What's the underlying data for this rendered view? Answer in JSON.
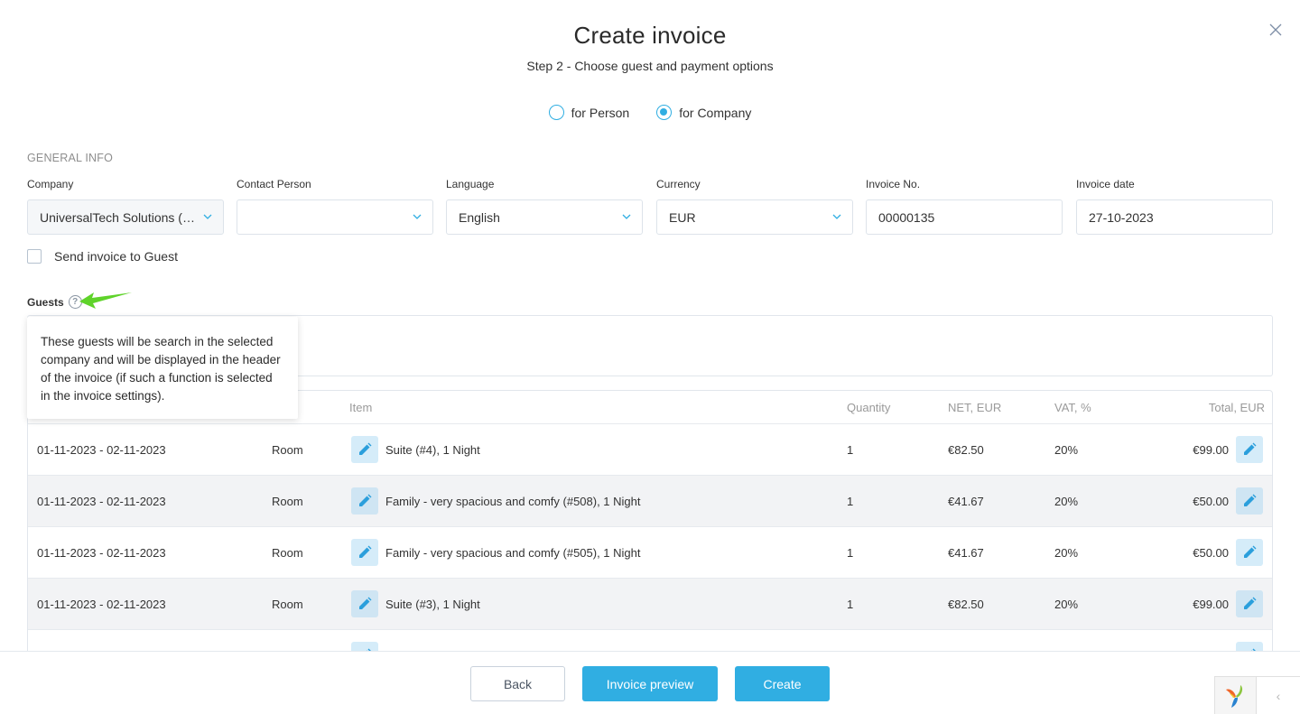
{
  "header": {
    "title": "Create invoice",
    "subtitle": "Step 2 - Choose guest and payment options"
  },
  "recipient_type": {
    "options": [
      {
        "label": "for Person",
        "selected": false
      },
      {
        "label": "for Company",
        "selected": true
      }
    ]
  },
  "general_info": {
    "section_title": "GENERAL INFO",
    "company": {
      "label": "Company",
      "value": "UniversalTech Solutions (B..."
    },
    "contact_person": {
      "label": "Contact Person",
      "value": ""
    },
    "language": {
      "label": "Language",
      "value": "English"
    },
    "currency": {
      "label": "Currency",
      "value": "EUR"
    },
    "invoice_no": {
      "label": "Invoice No.",
      "value": "00000135"
    },
    "invoice_date": {
      "label": "Invoice date",
      "value": "27-10-2023"
    },
    "send_to_guest": {
      "label": "Send invoice to Guest",
      "checked": false
    }
  },
  "guests": {
    "label": "Guests",
    "help_icon": "question-circle-icon",
    "tooltip": "These guests will be search in the selected company and will be displayed in the header of the invoice (if such a function is selected in the invoice settings)."
  },
  "table": {
    "columns": {
      "item": "Item",
      "quantity": "Quantity",
      "net": "NET, EUR",
      "vat": "VAT, %",
      "total": "Total, EUR"
    },
    "rows": [
      {
        "dates": "01-11-2023 - 02-11-2023",
        "type": "Room",
        "item": "Suite  (#4), 1 Night",
        "quantity": "1",
        "net": "€82.50",
        "vat": "20%",
        "total": "€99.00"
      },
      {
        "dates": "01-11-2023 - 02-11-2023",
        "type": "Room",
        "item": "Family - very spacious and comfy  (#508), 1 Night",
        "quantity": "1",
        "net": "€41.67",
        "vat": "20%",
        "total": "€50.00"
      },
      {
        "dates": "01-11-2023 - 02-11-2023",
        "type": "Room",
        "item": "Family - very spacious and comfy  (#505), 1 Night",
        "quantity": "1",
        "net": "€41.67",
        "vat": "20%",
        "total": "€50.00"
      },
      {
        "dates": "01-11-2023 - 02-11-2023",
        "type": "Room",
        "item": "Suite  (#3), 1 Night",
        "quantity": "1",
        "net": "€82.50",
        "vat": "20%",
        "total": "€99.00"
      },
      {
        "dates": "",
        "type": "",
        "item": "",
        "quantity": "",
        "net": "",
        "vat": "",
        "total": ""
      }
    ]
  },
  "footer": {
    "back_label": "Back",
    "preview_label": "Invoice preview",
    "create_label": "Create"
  },
  "colors": {
    "accent": "#30aee2",
    "annotation_arrow": "#5fd32a"
  }
}
